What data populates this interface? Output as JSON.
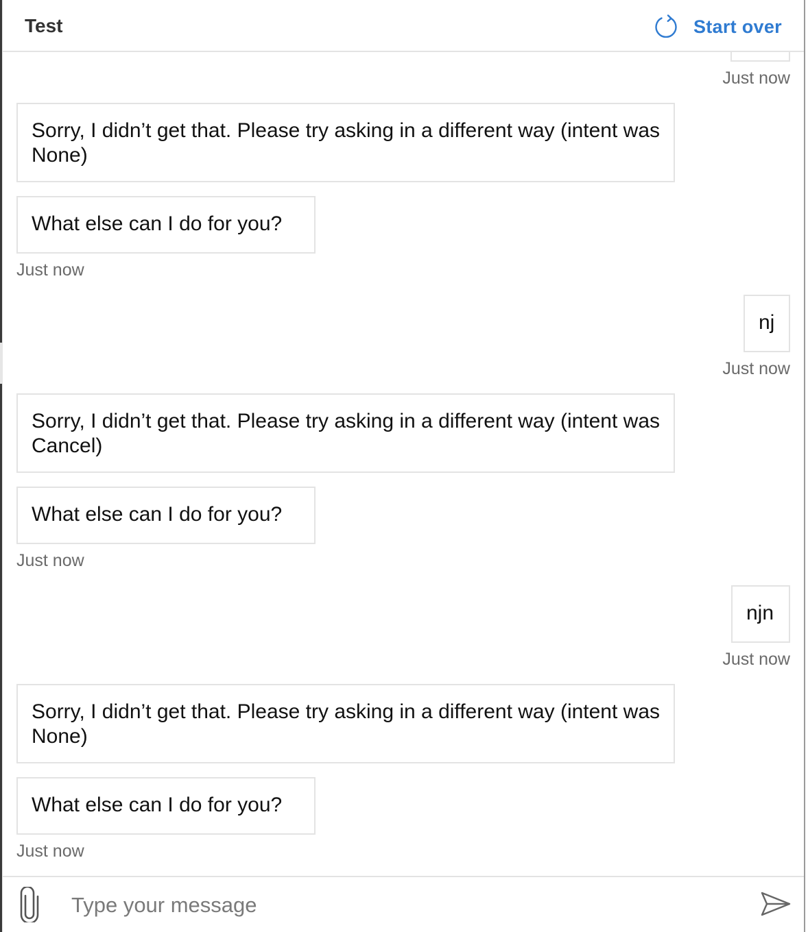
{
  "header": {
    "title": "Test",
    "start_over_label": "Start over"
  },
  "transcript": {
    "top_partial_timestamp": "Just now",
    "bot_group_1": {
      "msg_1": "Sorry, I didn’t get that. Please try asking in a different way (intent was None)",
      "msg_2": "What else can I do for you?",
      "timestamp": "Just now"
    },
    "user_msg_1": {
      "text": "nj",
      "timestamp": "Just now"
    },
    "bot_group_2": {
      "msg_1": "Sorry, I didn’t get that. Please try asking in a different way (intent was Cancel)",
      "msg_2": "What else can I do for you?",
      "timestamp": "Just now"
    },
    "user_msg_2": {
      "text": "njn",
      "timestamp": "Just now"
    },
    "bot_group_3": {
      "msg_1": "Sorry, I didn’t get that. Please try asking in a different way (intent was None)",
      "msg_2": "What else can I do for you?",
      "timestamp": "Just now"
    }
  },
  "composer": {
    "placeholder": "Type your message"
  },
  "icons": {
    "refresh": "refresh-icon",
    "attach": "paperclip-icon",
    "send": "send-icon"
  },
  "colors": {
    "accent": "#2f7bd1",
    "border": "#e3e3e3",
    "timestamp": "#6a6a6a"
  }
}
